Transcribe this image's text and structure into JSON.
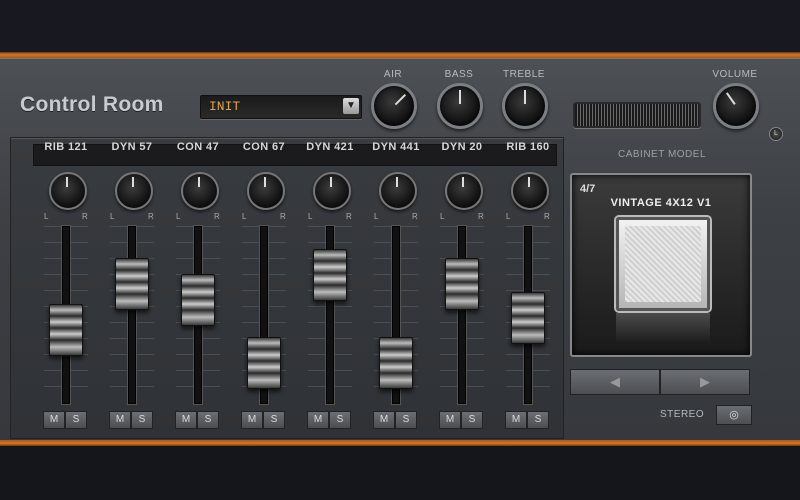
{
  "header": {
    "title": "Control Room",
    "preset": {
      "value": "INIT",
      "arrow": "▼"
    },
    "knobs": [
      {
        "label": "AIR"
      },
      {
        "label": "BASS"
      },
      {
        "label": "TREBLE"
      },
      {
        "label": "VOLUME"
      }
    ]
  },
  "mixer": {
    "pan_left": "L",
    "pan_right": "R",
    "mute_label": "M",
    "solo_label": "S",
    "channels": [
      {
        "name": "RIB 121",
        "fader_level": 0.38
      },
      {
        "name": "DYN 57",
        "fader_level": 0.75
      },
      {
        "name": "CON 47",
        "fader_level": 0.62
      },
      {
        "name": "CON 67",
        "fader_level": 0.12
      },
      {
        "name": "DYN 421",
        "fader_level": 0.82
      },
      {
        "name": "DYN 441",
        "fader_level": 0.12
      },
      {
        "name": "DYN 20",
        "fader_level": 0.75
      },
      {
        "name": "RIB 160",
        "fader_level": 0.48
      }
    ]
  },
  "cabinet": {
    "label": "CABINET MODEL",
    "count": "4/7",
    "name": "VINTAGE 4X12 V1",
    "prev": "◀",
    "next": "▶",
    "stereo_label": "STEREO"
  }
}
